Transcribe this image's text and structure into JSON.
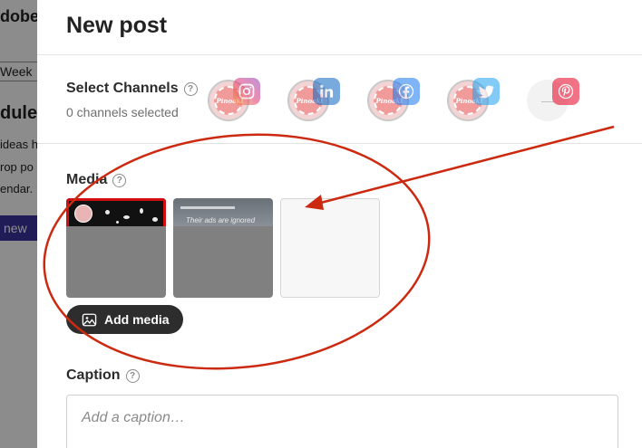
{
  "background": {
    "title_fragment": "dobe",
    "week_label": "Week",
    "heading_fragment": "dule",
    "lines": [
      "ideas h",
      "rop po",
      "endar."
    ],
    "new_button": "new"
  },
  "modal": {
    "title": "New post",
    "channels": {
      "label": "Select Channels",
      "count_text": "0 channels selected",
      "avatar_text": "Pinoak",
      "items": [
        {
          "network": "Instagram",
          "icon": "instagram-icon",
          "color": "#e1306c"
        },
        {
          "network": "LinkedIn",
          "icon": "linkedin-icon",
          "color": "#0a66c2"
        },
        {
          "network": "Facebook",
          "icon": "facebook-icon",
          "color": "#1877f2"
        },
        {
          "network": "Twitter",
          "icon": "twitter-icon",
          "color": "#1da1f2"
        },
        {
          "network": "Pinterest",
          "icon": "pinterest-icon",
          "color": "#e60023"
        }
      ]
    },
    "media": {
      "label": "Media",
      "thumb2_caption": "Their ads are ignored",
      "add_button": "Add media"
    },
    "caption": {
      "label": "Caption",
      "placeholder": "Add a caption…"
    }
  },
  "colors": {
    "annotation": "#cc2a10",
    "overlay": "rgba(0,0,0,0.45)"
  }
}
